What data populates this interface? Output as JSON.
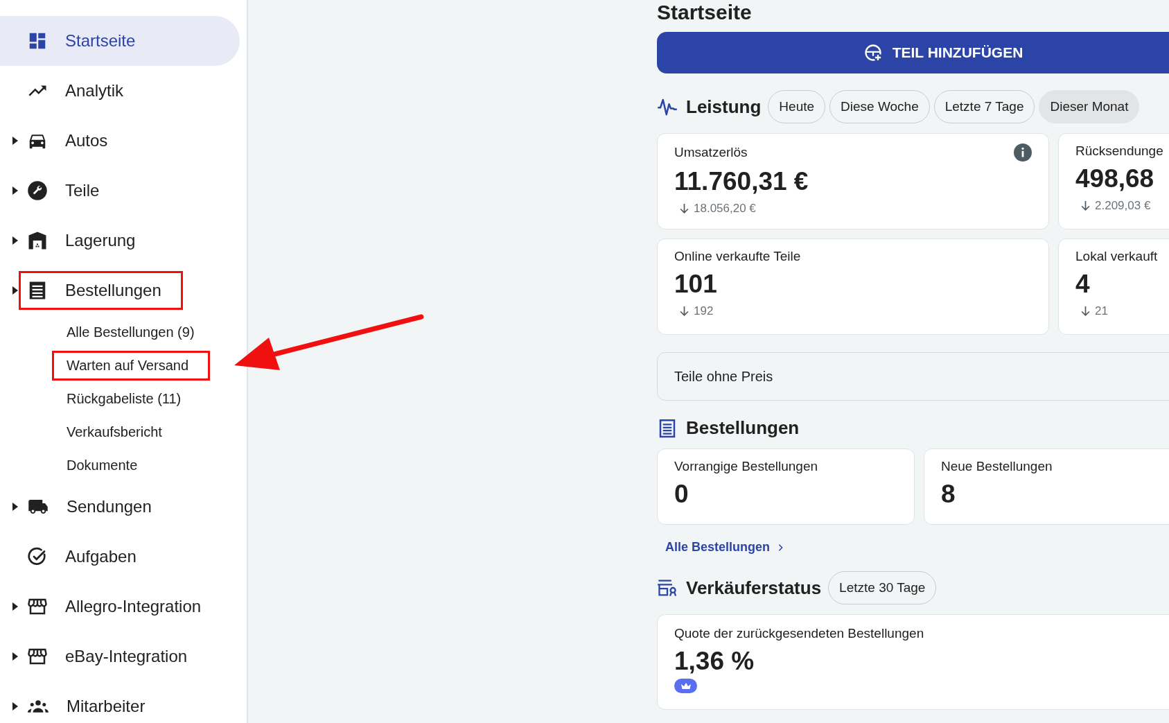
{
  "sidebar": {
    "items": [
      {
        "label": "Startseite",
        "selected": true,
        "expandable": false,
        "highlighted": false
      },
      {
        "label": "Analytik",
        "selected": false,
        "expandable": false,
        "highlighted": false
      },
      {
        "label": "Autos",
        "selected": false,
        "expandable": true,
        "highlighted": false
      },
      {
        "label": "Teile",
        "selected": false,
        "expandable": true,
        "highlighted": false
      },
      {
        "label": "Lagerung",
        "selected": false,
        "expandable": true,
        "highlighted": false
      },
      {
        "label": "Bestellungen",
        "selected": false,
        "expandable": true,
        "highlighted": true,
        "children": [
          {
            "label": "Alle Bestellungen (9)",
            "highlighted": false,
            "arrow": false
          },
          {
            "label": "Warten auf Versand",
            "highlighted": true,
            "arrow": true
          },
          {
            "label": "Rückgabeliste (11)",
            "highlighted": false,
            "arrow": false
          },
          {
            "label": "Verkaufsbericht",
            "highlighted": false,
            "arrow": false
          },
          {
            "label": "Dokumente",
            "highlighted": false,
            "arrow": false
          }
        ]
      },
      {
        "label": "Sendungen",
        "selected": false,
        "expandable": true,
        "highlighted": false
      },
      {
        "label": "Aufgaben",
        "selected": false,
        "expandable": false,
        "highlighted": false
      },
      {
        "label": "Allegro-Integration",
        "selected": false,
        "expandable": true,
        "highlighted": false
      },
      {
        "label": "eBay-Integration",
        "selected": false,
        "expandable": true,
        "highlighted": false
      },
      {
        "label": "Mitarbeiter",
        "selected": false,
        "expandable": true,
        "highlighted": false
      }
    ]
  },
  "page_title": "Startseite",
  "add_button": "TEIL HINZUFÜGEN",
  "performance": {
    "title": "Leistung",
    "periods": [
      {
        "label": "Heute",
        "selected": false
      },
      {
        "label": "Diese Woche",
        "selected": false
      },
      {
        "label": "Letzte 7 Tage",
        "selected": false
      },
      {
        "label": "Dieser Monat",
        "selected": true
      }
    ],
    "cards": [
      {
        "label": "Umsatzerlös",
        "value": "11.760,31 €",
        "previous": "18.056,20 €",
        "info": true
      },
      {
        "label": "Rücksendunge",
        "value": "498,68",
        "previous": "2.209,03 €",
        "info": false
      },
      {
        "label": "Online verkaufte Teile",
        "value": "101",
        "previous": "192",
        "info": false
      },
      {
        "label": "Lokal verkauft",
        "value": "4",
        "previous": "21",
        "info": false
      }
    ]
  },
  "unpriced_parts": "Teile ohne Preis",
  "orders": {
    "title": "Bestellungen",
    "cards": [
      {
        "label": "Vorrangige Bestellungen",
        "value": "0"
      },
      {
        "label": "Neue Bestellungen",
        "value": "8"
      }
    ],
    "link": "Alle Bestellungen"
  },
  "seller_status": {
    "title": "Verkäuferstatus",
    "period": "Letzte 30 Tage",
    "cards": [
      {
        "label": "Quote der zurückgesendeten Bestellungen",
        "value": "1,36 %",
        "premium_badge": true
      }
    ]
  }
}
